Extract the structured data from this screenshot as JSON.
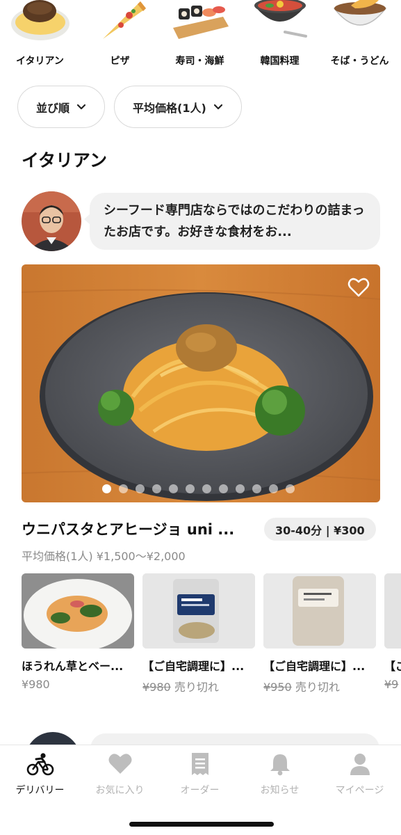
{
  "categories": [
    {
      "label": "イタリアン",
      "icon": "hamburg-steak-icon"
    },
    {
      "label": "ピザ",
      "icon": "pizza-icon"
    },
    {
      "label": "寿司・海鮮",
      "icon": "sushi-icon"
    },
    {
      "label": "韓国料理",
      "icon": "bibimbap-icon"
    },
    {
      "label": "そば・うどん",
      "icon": "tempura-soba-icon"
    }
  ],
  "filters": {
    "sort_label": "並び順",
    "avg_price_label": "平均価格(1人)"
  },
  "section_title": "イタリアン",
  "restaurant": {
    "comment": "シーフード専門店ならではのこだわりの詰まったお店です。お好きな食材をお...",
    "name": "ウニパスタとアヒージョ uni ...",
    "delivery_badge": "30-40分 | ¥300",
    "price_range": "平均価格(1人) ¥1,500〜¥2,000",
    "carousel": {
      "count": 12,
      "active_index": 0
    }
  },
  "menu_items": [
    {
      "name": "ほうれん草とベー...",
      "price": "¥980",
      "old_price": "",
      "status": ""
    },
    {
      "name": "【ご自宅調理に】...",
      "price": "",
      "old_price": "¥980",
      "status": "売り切れ"
    },
    {
      "name": "【ご自宅調理に】...",
      "price": "",
      "old_price": "¥950",
      "status": "売り切れ"
    },
    {
      "name": "【ご",
      "price": "",
      "old_price": "¥9",
      "status": ""
    }
  ],
  "tabbar": [
    {
      "label": "デリバリー",
      "icon": "bicycle-icon",
      "active": true
    },
    {
      "label": "お気に入り",
      "icon": "heart-icon",
      "active": false
    },
    {
      "label": "オーダー",
      "icon": "receipt-icon",
      "active": false
    },
    {
      "label": "お知らせ",
      "icon": "bell-icon",
      "active": false
    },
    {
      "label": "マイページ",
      "icon": "person-icon",
      "active": false
    }
  ],
  "colors": {
    "active": "#111111",
    "inactive": "#b3b3b3",
    "chip_border": "#d9d9d9"
  }
}
